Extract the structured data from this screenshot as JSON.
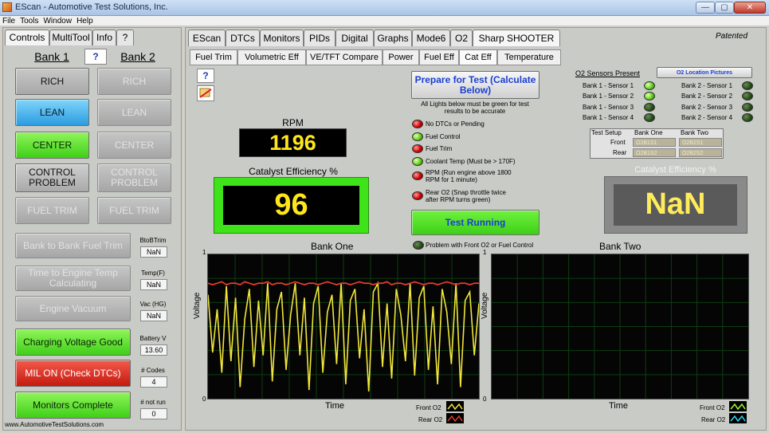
{
  "window": {
    "title": "EScan - Automotive Test Solutions, Inc.",
    "min": "—",
    "max": "▢",
    "close": "✕"
  },
  "menu": [
    "File",
    "Tools",
    "Window",
    "Help"
  ],
  "left_tabs": [
    "Controls",
    "MultiTool",
    "Info",
    "?"
  ],
  "bank1": "Bank 1",
  "bank_q": "?",
  "bank2": "Bank 2",
  "bank1_buttons": {
    "rich": "RICH",
    "lean": "LEAN",
    "center": "CENTER",
    "control_problem": "CONTROL PROBLEM",
    "fuel_trim": "FUEL TRIM"
  },
  "bank2_buttons": {
    "rich": "RICH",
    "lean": "LEAN",
    "center": "CENTER",
    "control_problem": "CONTROL PROBLEM",
    "fuel_trim": "FUEL TRIM"
  },
  "status": {
    "bank_to_bank": {
      "label": "Bank to Bank Fuel Trim",
      "sub": "BtoBTrim",
      "value": "NaN"
    },
    "time_to_temp": {
      "label": "Time to Engine Temp Calculating",
      "sub": "Temp(F)",
      "value": "NaN"
    },
    "vacuum": {
      "label": "Engine Vacuum",
      "sub": "Vac (HG)",
      "value": "NaN"
    },
    "charging": {
      "label": "Charging Voltage Good",
      "sub": "Battery V",
      "value": "13.60"
    },
    "mil": {
      "label": "MIL ON (Check DTCs)",
      "sub": "# Codes",
      "value": "4"
    },
    "monitors": {
      "label": "Monitors Complete",
      "sub": "# not run",
      "value": "0"
    }
  },
  "footer_url": "www.AutomotiveTestSolutions.com",
  "main_tabs": [
    "EScan",
    "DTCs",
    "Monitors",
    "PIDs",
    "Digital",
    "Graphs",
    "Mode6",
    "O2",
    "Sharp SHOOTER"
  ],
  "patented": "Patented",
  "sub_tabs": [
    "Fuel Trim",
    "Volumetric Eff",
    "VE/TFT Compare",
    "Power",
    "Fuel Eff",
    "Cat Eff",
    "Temperature"
  ],
  "help_q": "?",
  "rpm": {
    "label": "RPM",
    "value": "1196"
  },
  "cat_eff": {
    "label": "Catalyst Efficiency %",
    "value": "96"
  },
  "prepare": {
    "label": "Prepare for Test (Calculate Below)",
    "note": "All Lights below must be green for test results to be accurate"
  },
  "conditions": [
    {
      "text": "No DTCs or Pending",
      "state": "red"
    },
    {
      "text": "Fuel Control",
      "state": "green"
    },
    {
      "text": "Fuel Trim",
      "state": "red"
    },
    {
      "text": "Coolant Temp (Must be > 170F)",
      "state": "green"
    },
    {
      "text": "RPM (Run engine above 1800 RPM for 1 minute)",
      "state": "red"
    },
    {
      "text": "Rear O2 (Snap throttle twice after RPM turns green)",
      "state": "red"
    }
  ],
  "test_running": "Test Running",
  "problem_text": "Problem with Front O2 or Fuel Control",
  "o2_present": {
    "title": "O2 Sensors Present",
    "location_btn": "O2 Location Pictures",
    "bank1": [
      {
        "label": "Bank 1 - Sensor 1",
        "state": "green"
      },
      {
        "label": "Bank 1 - Sensor 2",
        "state": "green"
      },
      {
        "label": "Bank 1 - Sensor 3",
        "state": "dark"
      },
      {
        "label": "Bank 1 - Sensor 4",
        "state": "dark"
      }
    ],
    "bank2": [
      {
        "label": "Bank 2 - Sensor 1",
        "state": "dark"
      },
      {
        "label": "Bank 2 - Sensor 2",
        "state": "dark"
      },
      {
        "label": "Bank 2 - Sensor 3",
        "state": "dark"
      },
      {
        "label": "Bank 2 - Sensor 4",
        "state": "dark"
      }
    ]
  },
  "setup": {
    "header": [
      "Test Setup",
      "Bank One",
      "Bank Two"
    ],
    "front": "Front",
    "rear": "Rear",
    "b1front": "O2B1S1",
    "b1rear": "O2B1S2",
    "b2front": "O2B2S1",
    "b2rear": "O2B2S2"
  },
  "cat_eff2": {
    "label": "Catalyst Efficiency %",
    "value": "NaN"
  },
  "graph1": {
    "title": "Bank One",
    "ylabel": "Voltage",
    "xlabel": "Time",
    "ytop": "1",
    "ybot": "0",
    "legend_front": "Front O2",
    "legend_rear": "Rear O2"
  },
  "graph2": {
    "title": "Bank Two",
    "ylabel": "Voltage",
    "xlabel": "Time",
    "ytop": "1",
    "ybot": "0",
    "legend_front": "Front O2",
    "legend_rear": "Rear O2"
  },
  "colors": {
    "front_o2": "#f0e63a",
    "rear_o2": "#e23a2c",
    "grid": "#0e3d10"
  },
  "chart_data": [
    {
      "type": "line",
      "title": "Bank One",
      "xlabel": "Time",
      "ylabel": "Voltage",
      "ylim": [
        0,
        1
      ],
      "grid": true,
      "legend": "bottom-right",
      "series": [
        {
          "name": "Front O2",
          "values": [
            0.72,
            0.32,
            0.62,
            0.18,
            0.78,
            0.26,
            0.7,
            0.08,
            0.55,
            0.76,
            0.22,
            0.68,
            0.3,
            0.8,
            0.12,
            0.62,
            0.74,
            0.2,
            0.58,
            0.8,
            0.3,
            0.7,
            0.06,
            0.66,
            0.78,
            0.18,
            0.6,
            0.72,
            0.24,
            0.8,
            0.1,
            0.68,
            0.76,
            0.28,
            0.62,
            0.05,
            0.74,
            0.8,
            0.22,
            0.66,
            0.14,
            0.76,
            0.58,
            0.26,
            0.8,
            0.16,
            0.7,
            0.78,
            0.2,
            0.64,
            0.1,
            0.76,
            0.6,
            0.24,
            0.8,
            0.08,
            0.68,
            0.74,
            0.3,
            0.66
          ]
        },
        {
          "name": "Rear O2",
          "values": [
            0.8,
            0.79,
            0.8,
            0.81,
            0.79,
            0.8,
            0.8,
            0.79,
            0.81,
            0.8,
            0.79,
            0.8,
            0.8,
            0.81,
            0.79,
            0.8,
            0.8,
            0.79,
            0.8,
            0.81,
            0.8,
            0.79,
            0.8,
            0.8,
            0.79,
            0.8,
            0.81,
            0.8,
            0.79,
            0.8,
            0.8,
            0.79,
            0.8,
            0.81,
            0.8,
            0.8,
            0.79,
            0.8,
            0.8,
            0.81,
            0.79,
            0.8,
            0.8,
            0.79,
            0.8,
            0.81,
            0.8,
            0.79,
            0.8,
            0.8,
            0.79,
            0.8,
            0.81,
            0.8,
            0.79,
            0.8,
            0.8,
            0.79,
            0.8,
            0.8
          ]
        }
      ]
    },
    {
      "type": "line",
      "title": "Bank Two",
      "xlabel": "Time",
      "ylabel": "Voltage",
      "ylim": [
        0,
        1
      ],
      "grid": true,
      "legend": "bottom-right",
      "series": [
        {
          "name": "Front O2",
          "values": []
        },
        {
          "name": "Rear O2",
          "values": []
        }
      ]
    }
  ]
}
